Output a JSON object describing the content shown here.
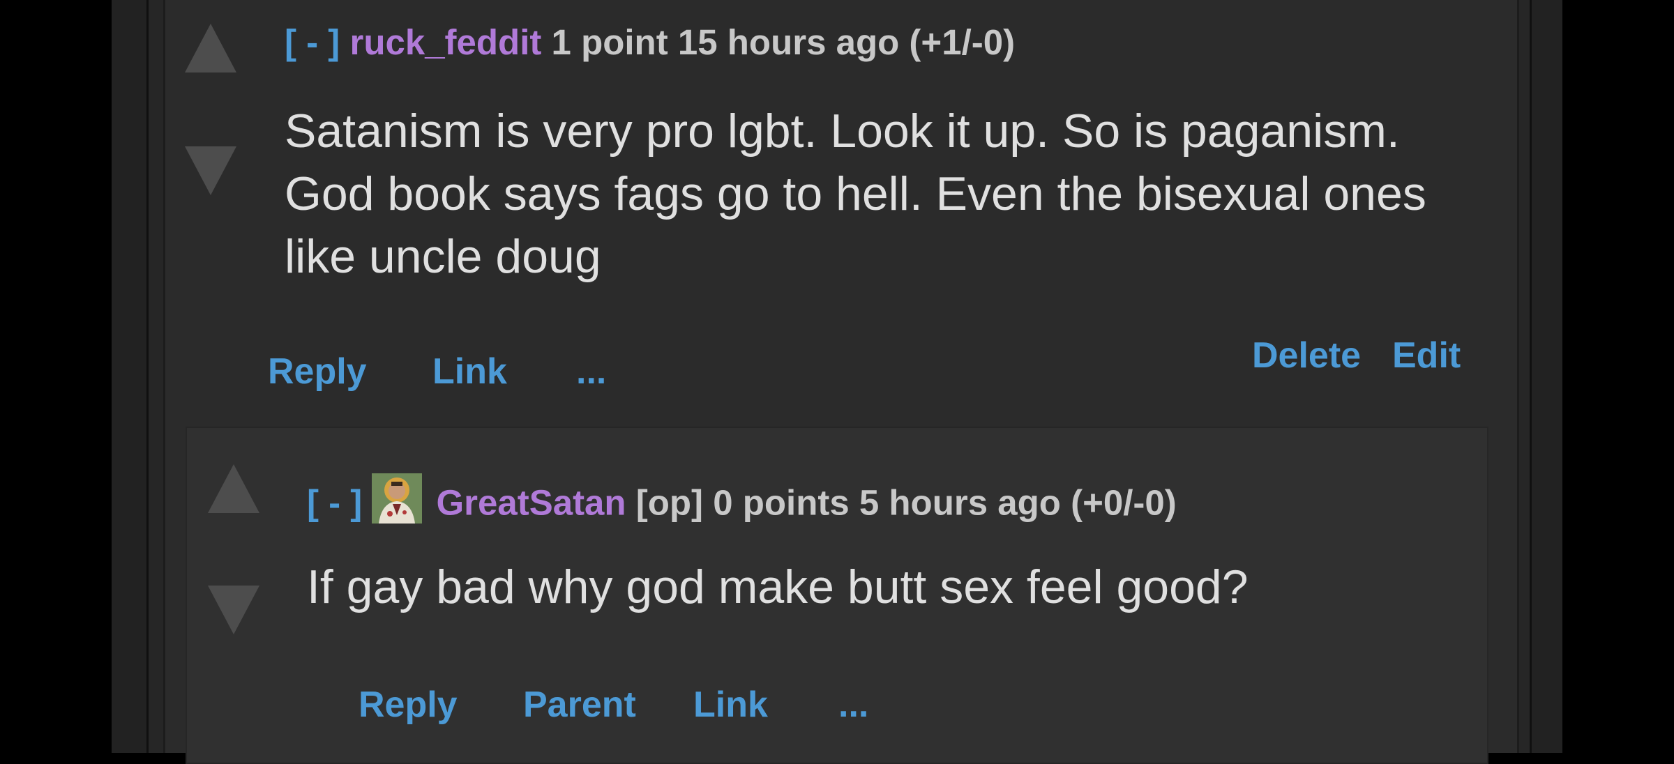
{
  "colors": {
    "background": "#2b2b2b",
    "link": "#4c9ad6",
    "username": "#b07ad8",
    "meta_text": "#c8c8c8",
    "body_text": "#e0e0e0",
    "vote_arrow": "#4d4d4d"
  },
  "comment": {
    "toggle": "[ - ]",
    "username": "ruck_feddit",
    "meta": "1 point 15 hours ago (+1/-0)",
    "body": "Satanism is very pro lgbt. Look it up. So is paganism. God book says fags go to hell. Even the bisexual ones like uncle doug",
    "actions": {
      "reply": "Reply",
      "link": "Link",
      "more": "...",
      "delete": "Delete",
      "edit": "Edit"
    },
    "upvote_icon": "upvote-arrow",
    "downvote_icon": "downvote-arrow"
  },
  "reply": {
    "toggle": "[ - ]",
    "avatar_icon": "user-avatar",
    "username": "GreatSatan",
    "meta": "[op] 0 points 5 hours ago (+0/-0)",
    "body": "If gay bad why god make butt sex feel good?",
    "actions": {
      "reply": "Reply",
      "parent": "Parent",
      "link": "Link",
      "more": "..."
    },
    "upvote_icon": "upvote-arrow",
    "downvote_icon": "downvote-arrow"
  }
}
